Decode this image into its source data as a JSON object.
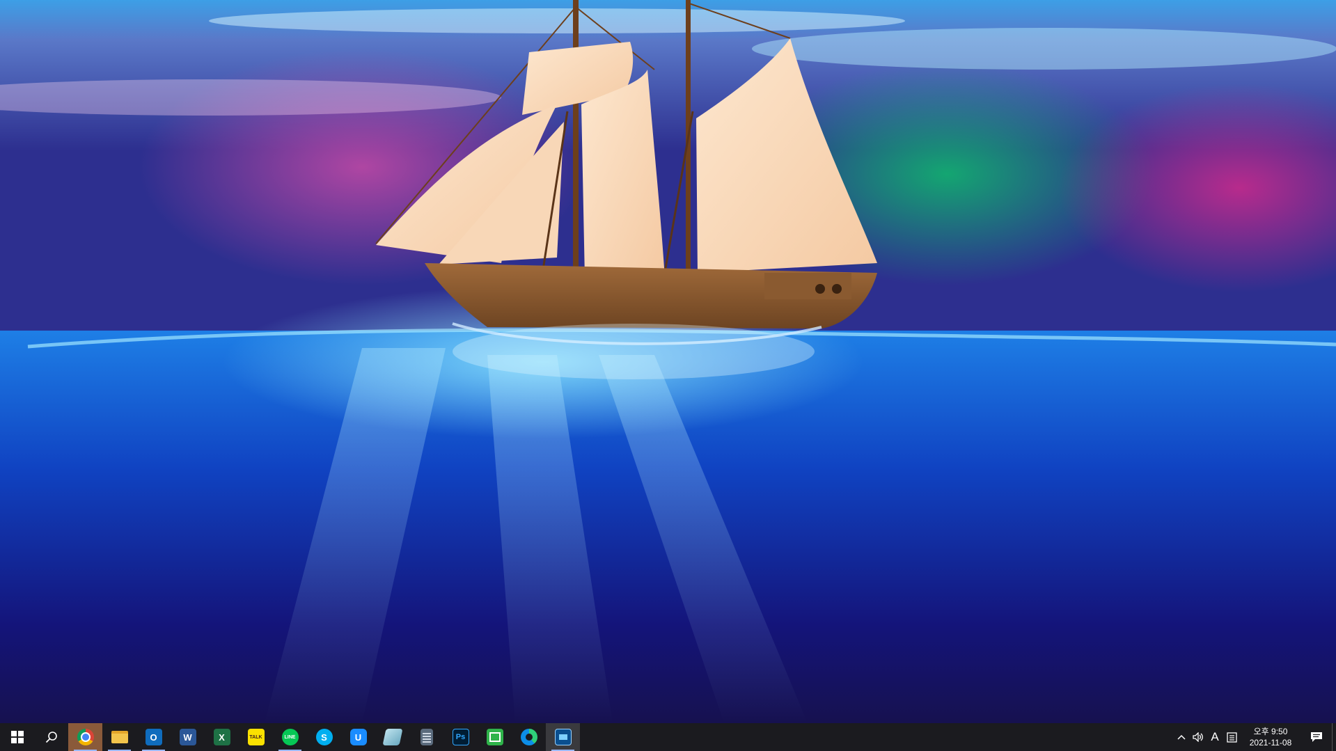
{
  "desktop": {
    "wallpaper": "sailing-ship-over-ocean-aurora"
  },
  "taskbar": {
    "start_icon": "windows-logo-icon",
    "search_icon": "search-icon",
    "apps": [
      {
        "name": "chrome",
        "icon": "chrome-icon",
        "label": ""
      },
      {
        "name": "file-explorer",
        "icon": "folder-icon",
        "label": ""
      },
      {
        "name": "outlook",
        "icon": "outlook-icon",
        "label": "O"
      },
      {
        "name": "word",
        "icon": "word-icon",
        "label": "W"
      },
      {
        "name": "excel",
        "icon": "excel-icon",
        "label": "X"
      },
      {
        "name": "kakaotalk",
        "icon": "kakaotalk-icon",
        "label": "TALK"
      },
      {
        "name": "line",
        "icon": "line-icon",
        "label": "LINE"
      },
      {
        "name": "skype",
        "icon": "skype-icon",
        "label": "S"
      },
      {
        "name": "app-u",
        "icon": "u-app-icon",
        "label": "U"
      },
      {
        "name": "notes",
        "icon": "notepad-icon",
        "label": ""
      },
      {
        "name": "calculator",
        "icon": "calculator-icon",
        "label": ""
      },
      {
        "name": "photoshop",
        "icon": "photoshop-icon",
        "label": "Ps"
      },
      {
        "name": "remote-app",
        "icon": "remote-app-icon",
        "label": ""
      },
      {
        "name": "edge",
        "icon": "edge-icon",
        "label": ""
      },
      {
        "name": "capture-tool",
        "icon": "capture-tool-icon",
        "label": ""
      }
    ],
    "tray": {
      "ime_mode": "A",
      "time": "오후 9:50",
      "date": "2021-11-08"
    }
  },
  "colors": {
    "taskbar_bg": "#1b1b1f",
    "accent": "#9ab8ff"
  }
}
